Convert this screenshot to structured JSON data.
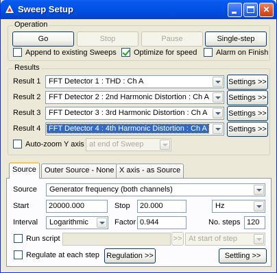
{
  "window": {
    "title": "Sweep Setup"
  },
  "operation": {
    "group_title": "Operation",
    "go": "Go",
    "stop": "Stop",
    "pause": "Pause",
    "single_step": "Single-step",
    "append_label": "Append to existing Sweeps",
    "append_checked": false,
    "optimize_label": "Optimize for speed",
    "optimize_checked": true,
    "alarm_label": "Alarm on Finish",
    "alarm_checked": false
  },
  "results": {
    "group_title": "Results",
    "rows": [
      {
        "label": "Result 1",
        "value": "FFT Detector 1 : THD : Ch A",
        "settings": "Settings >>"
      },
      {
        "label": "Result 2",
        "value": "FFT Detector 2 : 2nd Harmonic Distortion : Ch A",
        "settings": "Settings >>"
      },
      {
        "label": "Result 3",
        "value": "FFT Detector 3 : 3rd Harmonic Distortion : Ch A",
        "settings": "Settings >>"
      },
      {
        "label": "Result 4",
        "value": "FFT Detector 4 : 4th Harmonic Distortion : Ch A",
        "settings": "Settings >>"
      }
    ],
    "autozoom_label": "Auto-zoom Y axis",
    "autozoom_checked": false,
    "autozoom_when": "at end of Sweep"
  },
  "tabs": [
    "Source",
    "Outer Source - None",
    "X axis - as Source"
  ],
  "source": {
    "source_label": "Source",
    "source_value": "Generator frequency (both channels)",
    "start_label": "Start",
    "start_value": "20000.000",
    "stop_label": "Stop",
    "stop_value": "20.000",
    "unit_value": "Hz",
    "interval_label": "Interval",
    "interval_value": "Logarithmic",
    "factor_label": "Factor",
    "factor_value": "0.944",
    "steps_label": "No. steps",
    "steps_value": "120",
    "run_script_label": "Run script",
    "run_script_checked": false,
    "script_browse": ">>",
    "script_when": "At start of step",
    "regulate_label": "Regulate at each step",
    "regulate_checked": false,
    "regulation_button": "Regulation >>",
    "settling_button": "Settling >>"
  }
}
